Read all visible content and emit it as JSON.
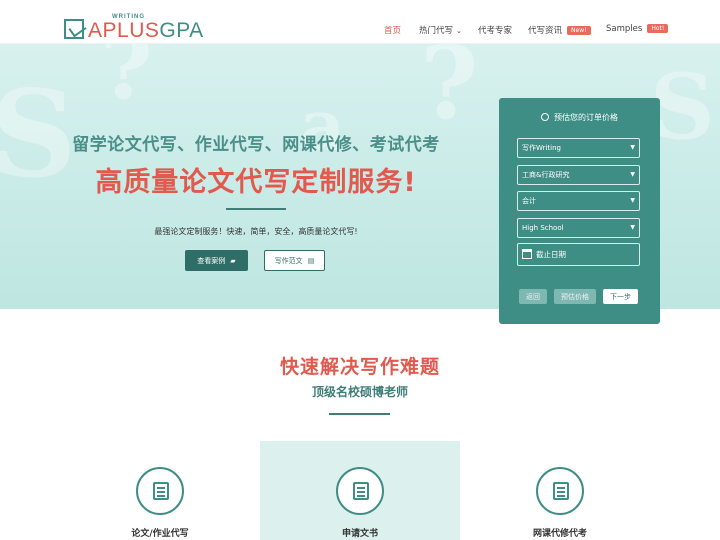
{
  "logo": {
    "small": "WRITING",
    "brand_a": "APLUS",
    "brand_b": "GPA"
  },
  "nav": [
    {
      "label": "首页"
    },
    {
      "label": "热门代写",
      "caret": "⌄"
    },
    {
      "label": "代考专家"
    },
    {
      "label": "代写资讯",
      "badge": "New!"
    },
    {
      "label": "Samples",
      "badge": "Hot!"
    }
  ],
  "hero": {
    "line1": "留学论文代写、作业代写、网课代修、考试代考",
    "line2": "高质量论文代写定制服务!",
    "subtitle": "最强论文定制服务！快速，简单，安全，高质量论文代写!",
    "btn_cases": "查看案例",
    "btn_samples": "写作范文"
  },
  "panel": {
    "title": "预估您的订单价格",
    "selects": [
      "写作Writing",
      "工商&行政研究",
      "会计",
      "High School"
    ],
    "date_placeholder": "截止日期",
    "btn_back": "返回",
    "btn_estimate": "预估价格",
    "btn_next": "下一步"
  },
  "section": {
    "title": "快速解决写作难题",
    "subtitle": "顶级名校硕博老师",
    "services": [
      "论文/作业代写",
      "申请文书",
      "网课代修代考"
    ]
  },
  "colors": {
    "accent": "#e05a4d",
    "brand": "#3f8e86",
    "dark_brand": "#2f6e67"
  }
}
